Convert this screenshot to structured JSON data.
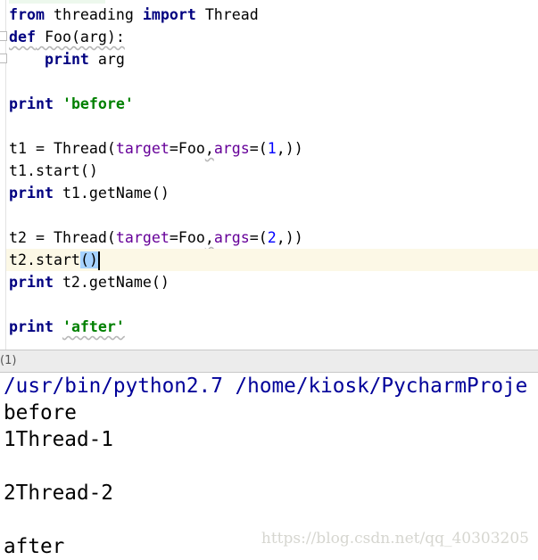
{
  "editor": {
    "current_line": 11,
    "lines": [
      [
        [
          "from",
          "kw"
        ],
        [
          " threading ",
          ""
        ],
        [
          "import",
          "kw"
        ],
        [
          " Thread",
          ""
        ]
      ],
      [
        [
          "def",
          "kw warn"
        ],
        [
          " Foo(arg):",
          "warn"
        ]
      ],
      [
        [
          "    ",
          ""
        ],
        [
          "print",
          "kw"
        ],
        [
          " arg",
          ""
        ]
      ],
      [],
      [
        [
          "print",
          "kw"
        ],
        [
          " ",
          ""
        ],
        [
          "'before'",
          "str"
        ]
      ],
      [],
      [
        [
          "t1 = Thread(",
          ""
        ],
        [
          "target",
          "param"
        ],
        [
          "=Foo",
          ""
        ],
        [
          ",",
          "warn"
        ],
        [
          "args",
          "param"
        ],
        [
          "=(",
          ""
        ],
        [
          "1",
          "num"
        ],
        [
          ",))",
          ""
        ]
      ],
      [
        [
          "t1.start()",
          ""
        ]
      ],
      [
        [
          "print",
          "kw"
        ],
        [
          " t1.getName()",
          ""
        ]
      ],
      [],
      [
        [
          "t2 = Thread(",
          ""
        ],
        [
          "target",
          "param"
        ],
        [
          "=Foo",
          ""
        ],
        [
          ",",
          "warn"
        ],
        [
          "args",
          "param"
        ],
        [
          "=(",
          ""
        ],
        [
          "2",
          "num"
        ],
        [
          ",))",
          ""
        ]
      ],
      [
        [
          "t2.start",
          ""
        ],
        [
          "()",
          "sel"
        ],
        [
          "",
          "caret"
        ]
      ],
      [
        [
          "print",
          "kw"
        ],
        [
          " t2.getName()",
          ""
        ]
      ],
      [],
      [
        [
          "print",
          "kw"
        ],
        [
          " ",
          ""
        ],
        [
          "'after'",
          "str warn"
        ]
      ]
    ]
  },
  "panel": {
    "label": "(1)"
  },
  "console": {
    "lines": [
      {
        "text": "/usr/bin/python2.7 /home/kiosk/PycharmProje",
        "type": "cmd"
      },
      {
        "text": "before",
        "type": "out"
      },
      {
        "text": "1Thread-1",
        "type": "out"
      },
      {
        "text": "",
        "type": "out"
      },
      {
        "text": "2Thread-2",
        "type": "out"
      },
      {
        "text": "",
        "type": "out"
      },
      {
        "text": "after",
        "type": "out"
      }
    ]
  },
  "watermark": "https://blog.csdn.net/qq_40303205"
}
